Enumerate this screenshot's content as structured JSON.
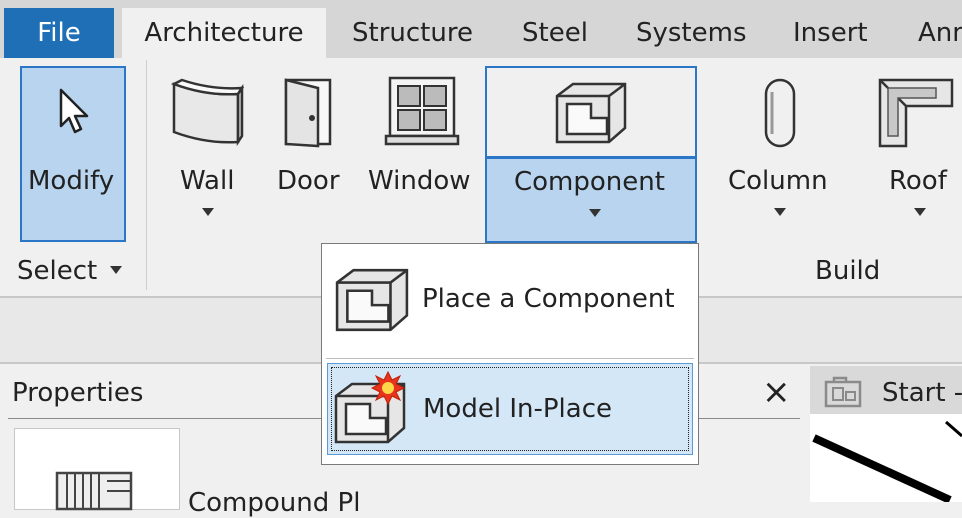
{
  "tabs": {
    "file": "File",
    "architecture": "Architecture",
    "structure": "Structure",
    "steel": "Steel",
    "systems": "Systems",
    "insert": "Insert",
    "annotate": "Ann"
  },
  "ribbon": {
    "modify": "Modify",
    "wall": "Wall",
    "door": "Door",
    "window": "Window",
    "component": "Component",
    "column": "Column",
    "roof": "Roof",
    "select_panel": "Select",
    "build_panel": "Build"
  },
  "dropdown": {
    "place_component": "Place a Component",
    "model_in_place": "Model In-Place"
  },
  "properties": {
    "title": "Properties",
    "close": "×",
    "type_name": "Compound Pl"
  },
  "view_tab": {
    "title": "Start -"
  },
  "colors": {
    "file_tab": "#1e6fb5",
    "selected": "#b8d4ee",
    "selected_border": "#2b76c6",
    "highlight": "#d3e7f7"
  }
}
